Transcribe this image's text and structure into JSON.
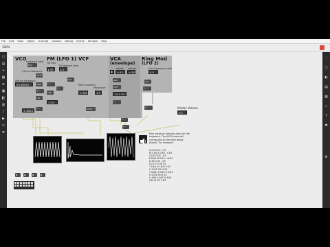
{
  "menubar": {
    "items": [
      "File",
      "Edit",
      "View",
      "Object",
      "Arrange",
      "Options",
      "Debug",
      "Extras",
      "Window",
      "Help"
    ]
  },
  "toolbar": {
    "zoom": "100%"
  },
  "modules": {
    "vco": {
      "title": "VCO",
      "keyboard_label": "keyboard input",
      "hz_label": "(Hz) to frequency",
      "detune_label": "detune frequency",
      "detune_value": "0.5.00007",
      "freq_value": "± 440.2"
    },
    "fm": {
      "title": "FM (LFO 1)",
      "fm_freq_label": "FM freq",
      "fm_amount_label": "FM amount ratio",
      "value": "1.75"
    },
    "vcf": {
      "title": "VCF",
      "filter_freq_label": "filter frequency",
      "resonance_label": "resonance",
      "filter_value": "1.9",
      "res_value": "< 300"
    },
    "vca": {
      "title": "VCA",
      "subtitle": "(envelope)",
      "attack_label": "attack",
      "release_label": "release",
      "attack_value": "< 6 1",
      "release_value": "< 50"
    },
    "ring": {
      "title": "Ring Mod",
      "subtitle": "(LFO 2)",
      "freq_label": "(Hz) frequency ratio",
      "value": "0.5"
    }
  },
  "master": {
    "label": "Master Volume",
    "value": "0.5"
  },
  "instructions": "Play notes by pressing keys on the keyboard. The ASCII code will correspond to the note being played. For example:",
  "key_table": [
    "A  C4  Z  C5  / C3",
    "W  C#4 S  C#5 ; C#3",
    "S  D4  X  D5  . D3",
    "E  D#4 D  D#5 L D#3",
    "D  E4  C  E5  , E3",
    "F  F4  V  F5  M F3",
    "T  F#4 G  F#5 J F#3",
    "G  G4  B  G5  N G3",
    "Y  G#4 H  G#5 H G#3",
    "H  A4  N  A5  B A3",
    "U  A#4 J  A#5 G A#3",
    "J  B4  M  B5  V B3"
  ],
  "colors": {
    "panel": "#b4b4b4",
    "screen_bg": "#ececec",
    "scope_bg": "#050505",
    "wave": "#ffffff",
    "cable": "#c9c56a"
  },
  "icons": [
    "lock-icon",
    "presentation-icon",
    "add-object-icon",
    "inspector-icon",
    "speaker-icon",
    "record-icon"
  ]
}
